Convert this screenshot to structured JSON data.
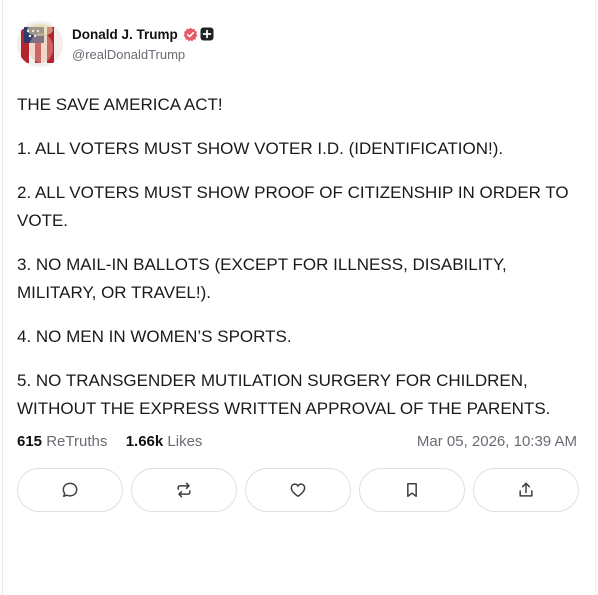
{
  "author": {
    "display_name": "Donald J. Trump",
    "handle": "@realDonaldTrump",
    "verified_icon": "verified-badge-icon",
    "plus_icon": "plus-badge-icon"
  },
  "post": {
    "paragraphs": [
      "THE SAVE AMERICA ACT!",
      "1. ALL VOTERS MUST SHOW VOTER I.D. (IDENTIFICATION!).",
      "2. ALL VOTERS MUST SHOW PROOF OF CITIZENSHIP IN ORDER TO VOTE.",
      "3. NO MAIL-IN BALLOTS (EXCEPT FOR ILLNESS, DISABILITY, MILITARY, OR TRAVEL!).",
      "4. NO MEN IN WOMEN’S SPORTS.",
      "5. NO TRANSGENDER MUTILATION SURGERY FOR CHILDREN, WITHOUT THE EXPRESS WRITTEN APPROVAL OF THE PARENTS."
    ]
  },
  "stats": {
    "retruths_count": "615",
    "retruths_label": "ReTruths",
    "likes_count": "1.66k",
    "likes_label": "Likes",
    "timestamp": "Mar 05, 2026, 10:39 AM"
  },
  "actions": [
    {
      "icon": "reply-icon"
    },
    {
      "icon": "retruth-icon"
    },
    {
      "icon": "heart-icon"
    },
    {
      "icon": "bookmark-icon"
    },
    {
      "icon": "share-icon"
    }
  ],
  "colors": {
    "verified": "#e35b64",
    "text": "#1a1a1a",
    "muted": "#6b6b76",
    "border": "#dedee3",
    "icon": "#3f3f46"
  }
}
